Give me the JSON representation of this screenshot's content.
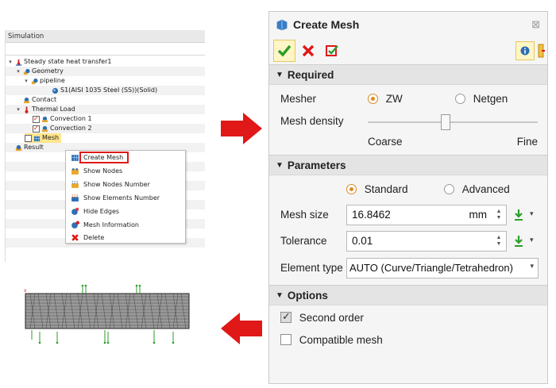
{
  "simulation": {
    "title": "Simulation",
    "tree": {
      "root": "Steady state heat transfer1",
      "geometry": "Geometry",
      "pipeline": "pipeline",
      "solid": "S1(AISI 1035 Steel (SS))(Solid)",
      "contact": "Contact",
      "thermal_load": "Thermal Load",
      "convection1": "Convection 1",
      "convection2": "Convection 2",
      "mesh": "Mesh",
      "result": "Result"
    },
    "context_menu": [
      {
        "label": "Create Mesh",
        "icon": "create-mesh-icon"
      },
      {
        "label": "Show Nodes",
        "icon": "show-nodes-icon"
      },
      {
        "label": "Show Nodes Number",
        "icon": "nodes-number-icon"
      },
      {
        "label": "Show Elements Number",
        "icon": "elements-number-icon"
      },
      {
        "label": "Hide Edges",
        "icon": "hide-edges-icon"
      },
      {
        "label": "Mesh Information",
        "icon": "mesh-info-icon"
      },
      {
        "label": "Delete",
        "icon": "delete-icon"
      }
    ]
  },
  "mesh_view": {
    "axis_label": "x"
  },
  "dialog": {
    "title": "Create Mesh",
    "required": {
      "header": "Required",
      "mesher_label": "Mesher",
      "mesher_options": [
        "ZW",
        "Netgen"
      ],
      "mesher_selected": "ZW",
      "density_label": "Mesh density",
      "density_min": "Coarse",
      "density_max": "Fine",
      "density_level": 0.46
    },
    "parameters": {
      "header": "Parameters",
      "modes": [
        "Standard",
        "Advanced"
      ],
      "mode_selected": "Standard",
      "mesh_size_label": "Mesh size",
      "mesh_size_value": "16.8462",
      "mesh_size_unit": "mm",
      "tolerance_label": "Tolerance",
      "tolerance_value": "0.01",
      "element_type_label": "Element type",
      "element_type_value": "AUTO (Curve/Triangle/Tetrahedron)"
    },
    "options": {
      "header": "Options",
      "second_order_label": "Second order",
      "second_order_checked": true,
      "compatible_label": "Compatible mesh",
      "compatible_checked": false
    }
  },
  "colors": {
    "accent_red": "#e01818",
    "ok_green": "#2e9e2a",
    "radio_orange": "#e08a1e",
    "icon_blue": "#2f6fb3"
  }
}
